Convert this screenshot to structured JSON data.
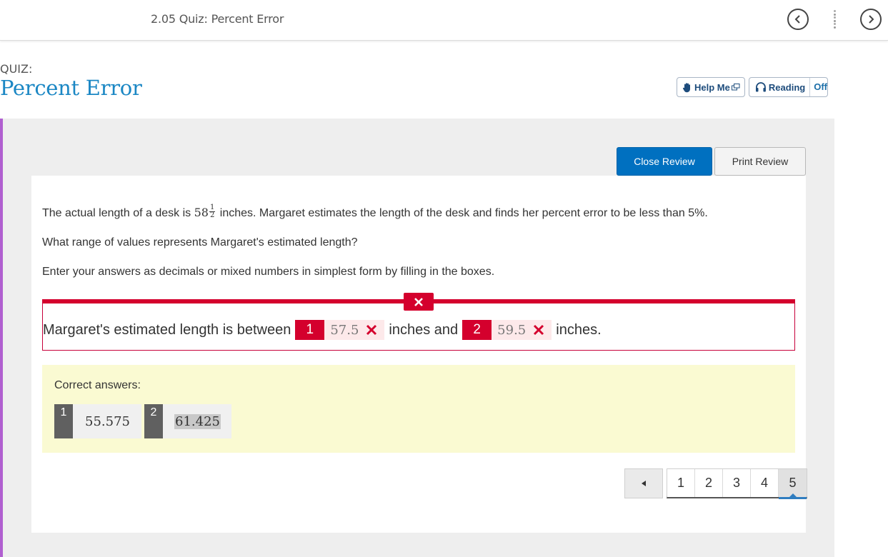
{
  "topbar": {
    "title": "2.05 Quiz: Percent Error"
  },
  "header": {
    "label": "QUIZ:",
    "title": "Percent Error",
    "help_label": "Help Me",
    "reading_label": "Reading",
    "reading_state": "Off"
  },
  "review": {
    "close_label": "Close Review",
    "print_label": "Print Review"
  },
  "question": {
    "line1_pre": "The actual length of a desk is ",
    "whole": "58",
    "frac_num": "1",
    "frac_den": "2",
    "line1_post": " inches. Margaret estimates the length of the desk and finds her percent error to be less than 5%.",
    "line2": "What range of values represents Margaret's estimated length?",
    "line3": "Enter your answers as decimals or mixed numbers in simplest form by filling in the boxes."
  },
  "answer": {
    "prefix": "Margaret's estimated length is between",
    "blank1_num": "1",
    "blank1_value": "57.5",
    "middle": "inches and",
    "blank2_num": "2",
    "blank2_value": "59.5",
    "suffix": "inches."
  },
  "correct": {
    "label": "Correct answers:",
    "items": [
      {
        "num": "1",
        "value": "55.575"
      },
      {
        "num": "2",
        "value": "61.425"
      }
    ]
  },
  "pager": {
    "pages": [
      "1",
      "2",
      "3",
      "4",
      "5"
    ],
    "current": "5"
  },
  "colors": {
    "accent_blue": "#0070c0",
    "title_blue": "#1b87c4",
    "error_red": "#d4002d",
    "correct_bg": "#fafad2",
    "left_accent": "#b05fd0"
  }
}
